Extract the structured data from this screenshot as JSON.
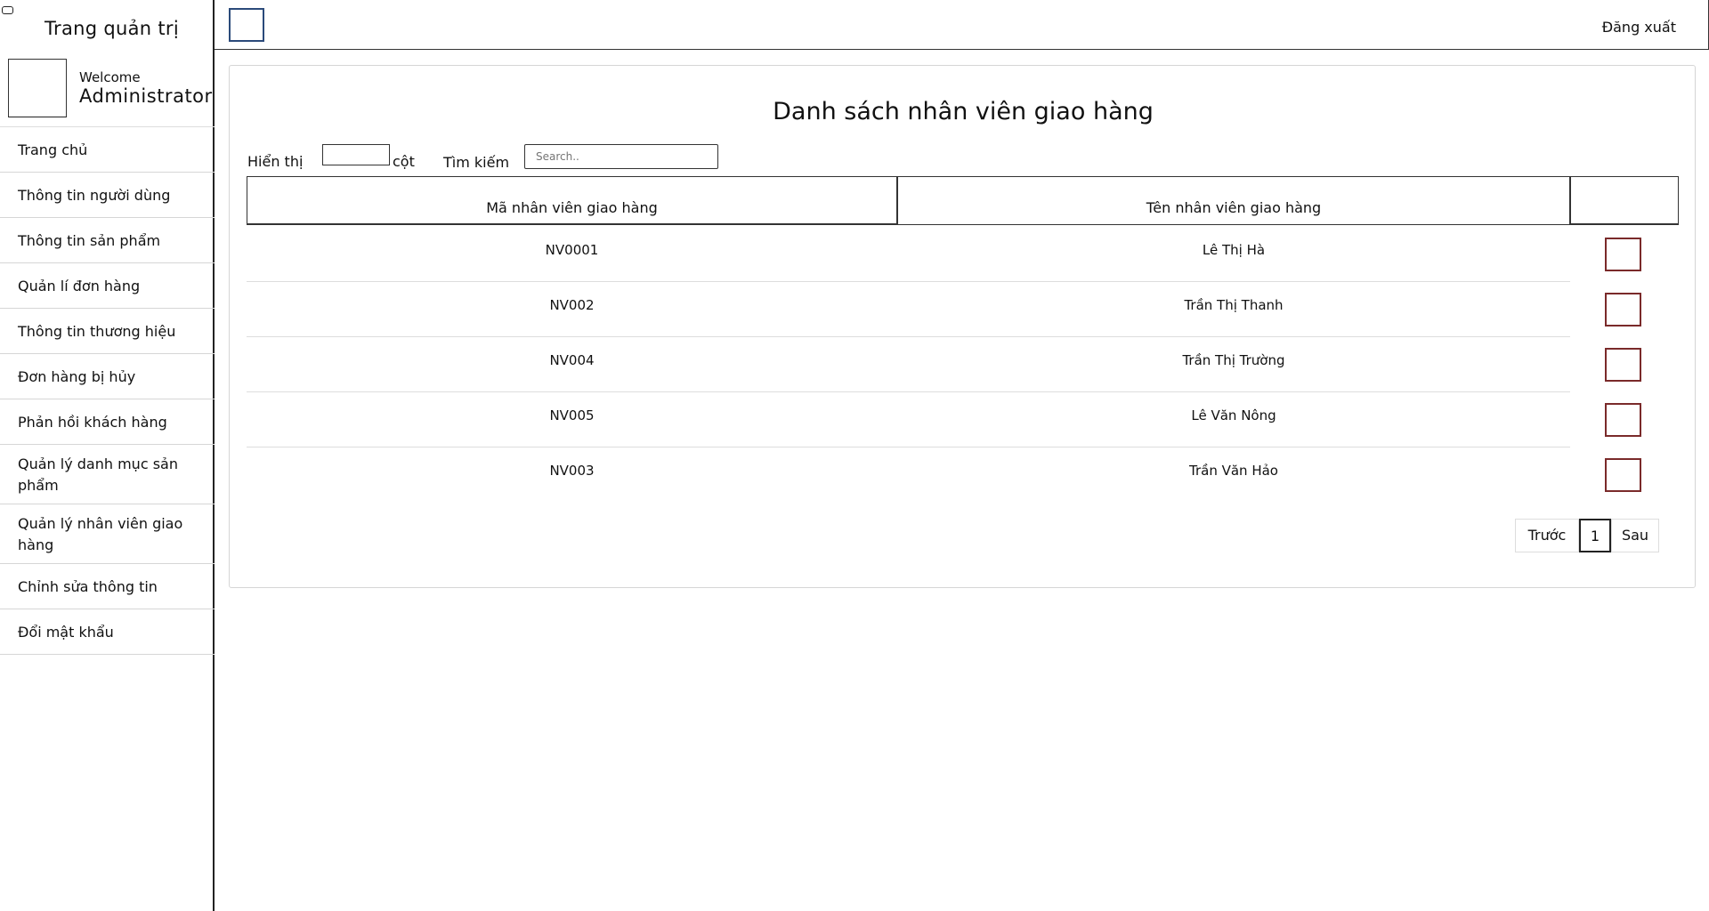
{
  "app": {
    "brand_title": "Trang quản trị",
    "logout_label": "Đăng xuất"
  },
  "profile": {
    "welcome": "Welcome",
    "name": "Administrator"
  },
  "menu": [
    "Trang chủ",
    "Thông tin người dùng",
    "Thông tin sản phẩm",
    "Quản lí đơn hàng",
    "Thông tin thương hiệu",
    "Đơn hàng bị hủy",
    "Phản hồi khách hàng",
    "Quản lý danh mục sản phẩm",
    "Quản lý nhân viên giao hàng",
    "Chỉnh sửa thông tin",
    "Đổi mật khẩu"
  ],
  "page": {
    "title": "Danh sách nhân viên giao hàng"
  },
  "controls": {
    "show_label": "Hiển thị",
    "show_value": "",
    "show_suffix": "cột",
    "search_label": "Tìm kiếm",
    "search_placeholder": "Search.."
  },
  "table": {
    "columns": [
      "Mã nhân viên giao hàng",
      "Tên nhân viên giao hàng",
      ""
    ],
    "rows": [
      {
        "id": "NV0001",
        "name": "Lê Thị Hà"
      },
      {
        "id": "NV002",
        "name": "Trần Thị Thanh"
      },
      {
        "id": "NV004",
        "name": "Trần Thị Trường"
      },
      {
        "id": "NV005",
        "name": "Lê Văn Nông"
      },
      {
        "id": "NV003",
        "name": "Trần Văn Hảo"
      }
    ]
  },
  "pagination": {
    "prev": "Trước",
    "current": "1",
    "next": "Sau"
  },
  "colors": {
    "toggle_border": "#2b4a7a",
    "action_box_border": "#7a2a2a"
  }
}
